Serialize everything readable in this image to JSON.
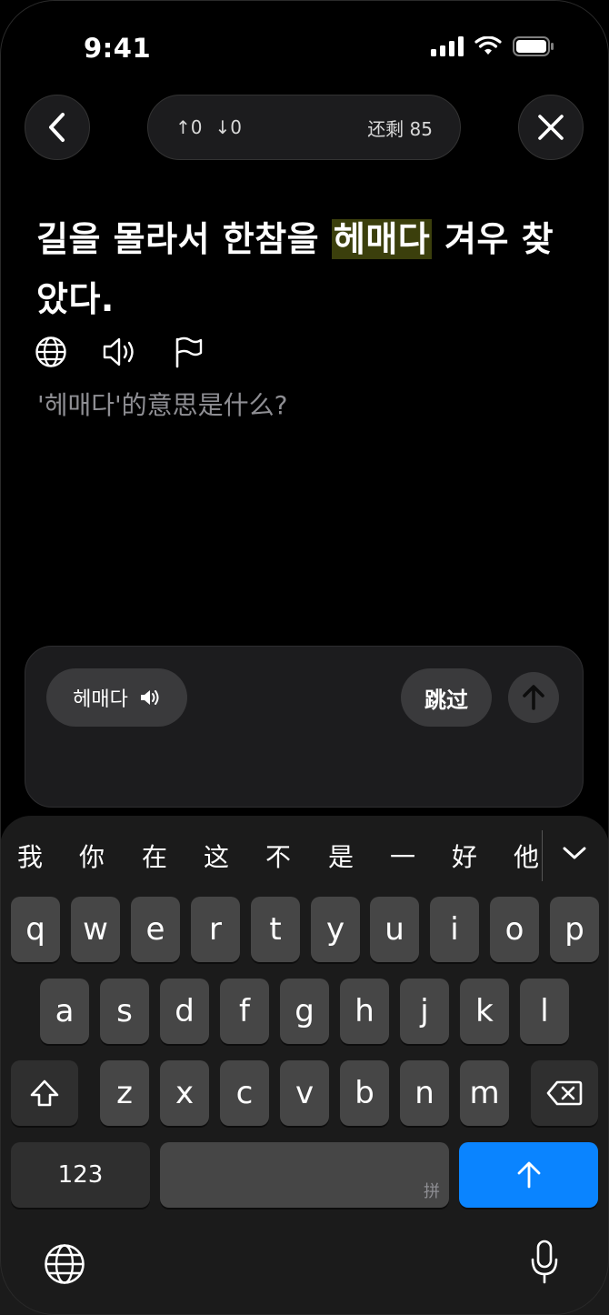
{
  "status_bar": {
    "time": "9:41"
  },
  "header": {
    "up_count": "↑0",
    "down_count": "↓0",
    "remaining": "还剩 85"
  },
  "sentence": {
    "before": "길을 몰라서 한참을 ",
    "highlight": "헤매다",
    "after": " 겨우 찾았다."
  },
  "question": "'헤매다'的意思是什么?",
  "answer_panel": {
    "word": "헤매다",
    "skip_label": "跳过"
  },
  "keyboard": {
    "candidates": [
      "我",
      "你",
      "在",
      "这",
      "不",
      "是",
      "一",
      "好",
      "他"
    ],
    "row1": [
      "q",
      "w",
      "e",
      "r",
      "t",
      "y",
      "u",
      "i",
      "o",
      "p"
    ],
    "row2": [
      "a",
      "s",
      "d",
      "f",
      "g",
      "h",
      "j",
      "k",
      "l"
    ],
    "row3": [
      "z",
      "x",
      "c",
      "v",
      "b",
      "n",
      "m"
    ],
    "numbers_label": "123",
    "space_hint": "拼"
  },
  "colors": {
    "highlight_bg": "#3b3f0c",
    "accent_blue": "#0a84ff",
    "panel_bg": "#1c1c1e"
  }
}
